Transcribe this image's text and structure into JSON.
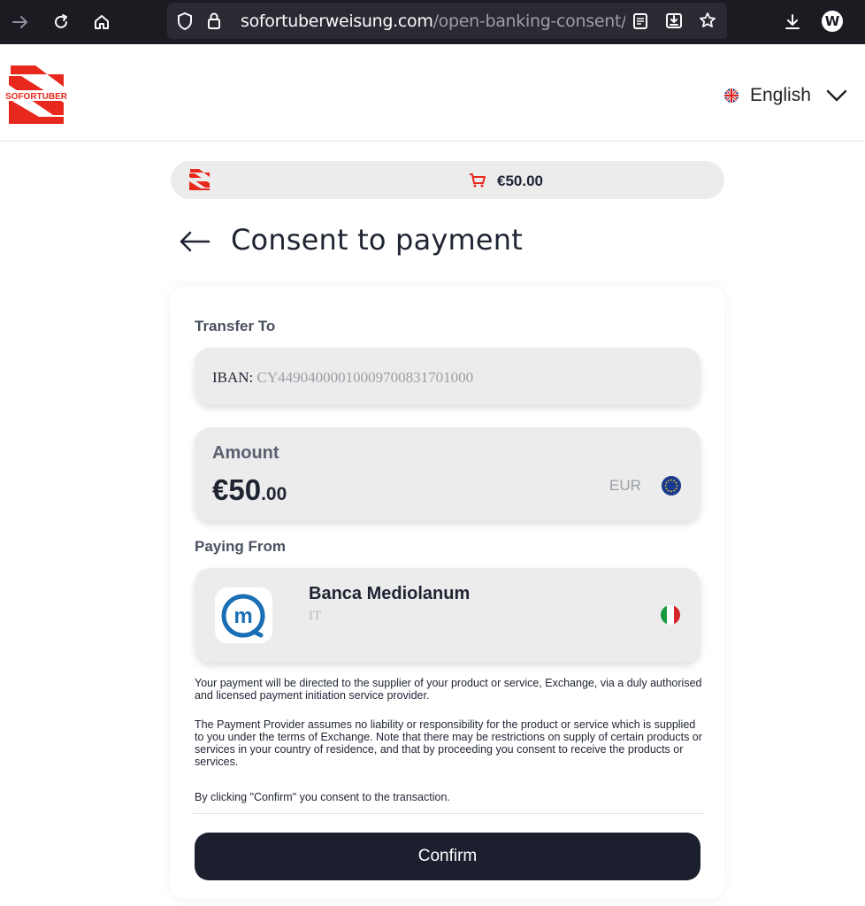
{
  "browser": {
    "url_host": "sofortuberweisung.com",
    "url_path": "/open-banking-consent/586",
    "profile_initial": "W"
  },
  "header": {
    "logo_text": "SOFORTUBER",
    "language": "English"
  },
  "summary": {
    "amount": "€50.00"
  },
  "page": {
    "title": "Consent to payment"
  },
  "transfer": {
    "section_label": "Transfer To",
    "iban_label": "IBAN:",
    "iban_value": "CY44904000010009700831701000"
  },
  "amount": {
    "label": "Amount",
    "whole": "€50",
    "cents": ".00",
    "currency": "EUR"
  },
  "paying_from": {
    "section_label": "Paying From",
    "bank_name": "Banca Mediolanum",
    "country": "IT"
  },
  "disclaimers": [
    "Your payment will be directed to the supplier of your product or service, Exchange, via a duly authorised and licensed payment initiation service provider.",
    "The Payment Provider assumes no liability or responsibility for the product or service which is supplied to you under the terms of Exchange. Note that there may be restrictions on supply of certain products or services in your country of residence, and that by proceeding you consent to receive the products or services.",
    "By clicking \"Confirm\" you consent to the transaction."
  ],
  "actions": {
    "confirm_label": "Confirm"
  },
  "colors": {
    "brand_red": "#e8281c",
    "dark_navy": "#1c1f2e",
    "browser_bg": "#1c1b22"
  },
  "icons": {
    "forward": "arrow-right-icon",
    "reload": "reload-icon",
    "home": "home-icon",
    "shield": "shield-icon",
    "lock": "lock-icon",
    "reader": "reader-view-icon",
    "save": "save-page-icon",
    "bookmark": "star-icon",
    "download": "download-icon",
    "cart": "cart-icon",
    "back": "back-arrow-icon",
    "chevron": "chevron-down-icon"
  }
}
